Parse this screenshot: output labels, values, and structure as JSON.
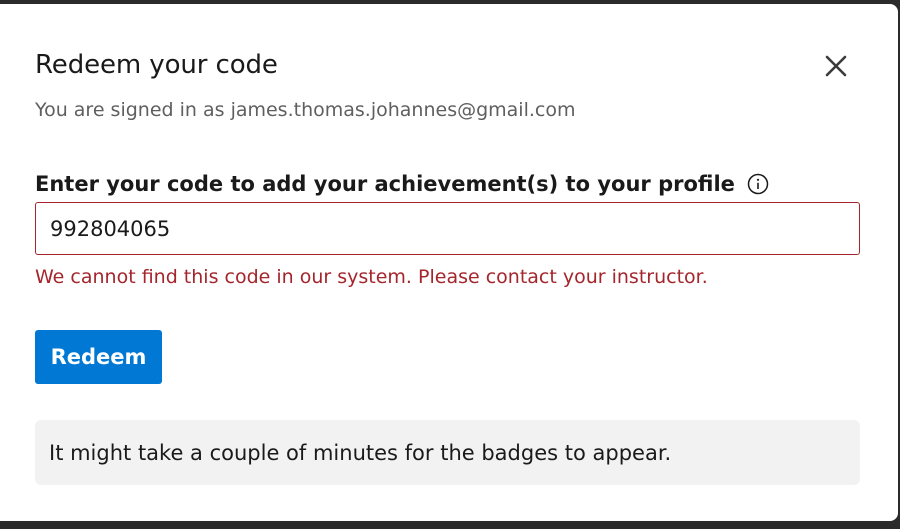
{
  "dialog": {
    "title": "Redeem your code",
    "signed_in_text": "You are signed in as james.thomas.johannes@gmail.com",
    "close_icon": "close-icon"
  },
  "code_field": {
    "label": "Enter your code to add your achievement(s) to your profile",
    "info_icon": "info-icon",
    "value": "992804065",
    "error": "We cannot find this code in our system. Please contact your instructor."
  },
  "actions": {
    "redeem_label": "Redeem"
  },
  "notice": {
    "text": "It might take a couple of minutes for the badges to appear."
  },
  "colors": {
    "accent": "#0078d4",
    "error": "#a4262c",
    "notice_bg": "#f2f2f2"
  }
}
